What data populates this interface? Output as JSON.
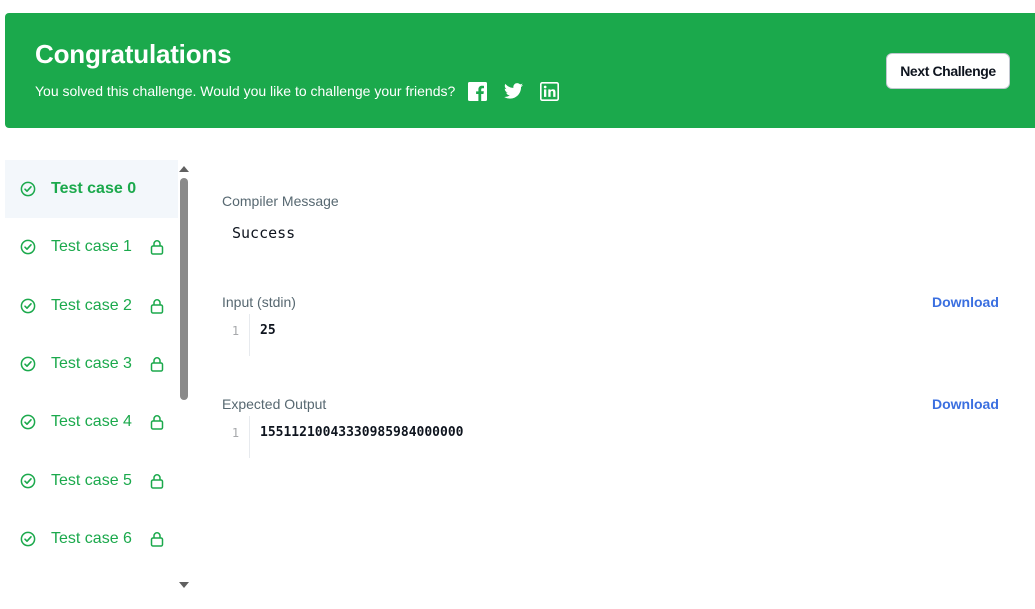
{
  "banner": {
    "title": "Congratulations",
    "subtitle": "You solved this challenge. Would you like to challenge your friends?",
    "social": [
      "facebook-icon",
      "twitter-icon",
      "linkedin-icon"
    ],
    "next_label": "Next Challenge",
    "color": "#1ba94c"
  },
  "test_cases": {
    "items": [
      {
        "label": "Test case 0",
        "status": "passed",
        "locked": false,
        "active": true
      },
      {
        "label": "Test case 1",
        "status": "passed",
        "locked": true,
        "active": false
      },
      {
        "label": "Test case 2",
        "status": "passed",
        "locked": true,
        "active": false
      },
      {
        "label": "Test case 3",
        "status": "passed",
        "locked": true,
        "active": false
      },
      {
        "label": "Test case 4",
        "status": "passed",
        "locked": true,
        "active": false
      },
      {
        "label": "Test case 5",
        "status": "passed",
        "locked": true,
        "active": false
      },
      {
        "label": "Test case 6",
        "status": "passed",
        "locked": true,
        "active": false
      }
    ]
  },
  "compiler": {
    "label": "Compiler Message",
    "message": "Success"
  },
  "input": {
    "label": "Input (stdin)",
    "download_label": "Download",
    "line_no": "1",
    "value": "25"
  },
  "expected": {
    "label": "Expected Output",
    "download_label": "Download",
    "line_no": "1",
    "value": "15511210043330985984000000"
  },
  "colors": {
    "success": "#1ba94c",
    "link": "#3a6fe0",
    "active_row": "#f3f7fb"
  }
}
